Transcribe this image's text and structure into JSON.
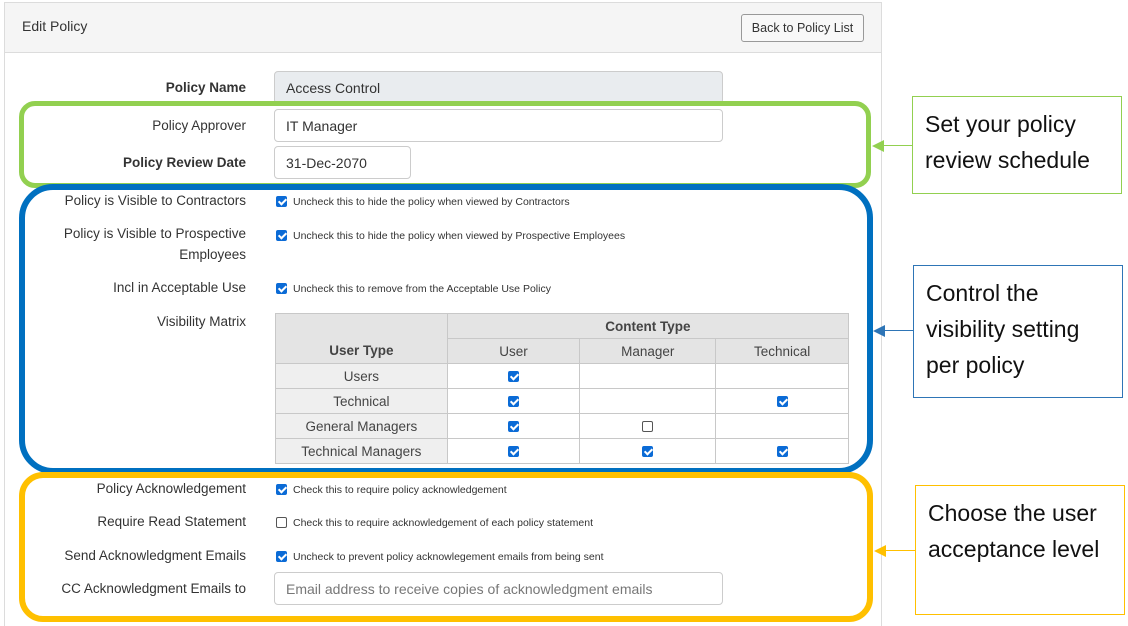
{
  "header": {
    "title": "Edit Policy",
    "back_button": "Back to Policy List"
  },
  "form": {
    "policy_name": {
      "label": "Policy Name",
      "value": "Access Control"
    },
    "policy_approver": {
      "label": "Policy Approver",
      "value": "IT Manager"
    },
    "review_date": {
      "label": "Policy Review Date",
      "value": "31-Dec-2070"
    },
    "visible_contractors": {
      "label": "Policy is Visible to Contractors",
      "checked": true,
      "hint": "Uncheck this to hide the policy when viewed by Contractors"
    },
    "visible_prospective": {
      "label_line1": "Policy is Visible to Prospective",
      "label_line2": "Employees",
      "checked": true,
      "hint": "Uncheck this to hide the policy when viewed by Prospective Employees"
    },
    "acceptable_use": {
      "label": "Incl in Acceptable Use",
      "checked": true,
      "hint": "Uncheck this to remove from the Acceptable Use Policy"
    },
    "visibility_matrix": {
      "label": "Visibility Matrix",
      "content_type_header": "Content Type",
      "user_type_header": "User Type",
      "columns": [
        "User",
        "Manager",
        "Technical"
      ],
      "rows": [
        {
          "user_type": "Users",
          "cells": [
            true,
            null,
            null
          ]
        },
        {
          "user_type": "Technical",
          "cells": [
            true,
            null,
            true
          ]
        },
        {
          "user_type": "General Managers",
          "cells": [
            true,
            false,
            null
          ]
        },
        {
          "user_type": "Technical Managers",
          "cells": [
            true,
            true,
            true
          ]
        }
      ]
    },
    "acknowledgement": {
      "label": "Policy Acknowledgement",
      "checked": true,
      "hint": "Check this to require policy acknowledgement"
    },
    "read_statement": {
      "label": "Require Read Statement",
      "checked": false,
      "hint": "Check this to require acknowledgement of each policy statement"
    },
    "send_emails": {
      "label": "Send Acknowledgment Emails",
      "checked": true,
      "hint": "Uncheck to prevent policy acknowlegement emails from being sent"
    },
    "cc_emails": {
      "label": "CC Acknowledgment Emails to",
      "value": "",
      "placeholder": "Email address to receive copies of acknowledgment emails"
    }
  },
  "callouts": {
    "review": {
      "text": "Set your policy review schedule",
      "color": "#92d050"
    },
    "visibility": {
      "text": "Control the visibility setting per policy",
      "color": "#0070c0"
    },
    "acceptance": {
      "text": "Choose the user acceptance level",
      "color": "#ffc000"
    }
  }
}
